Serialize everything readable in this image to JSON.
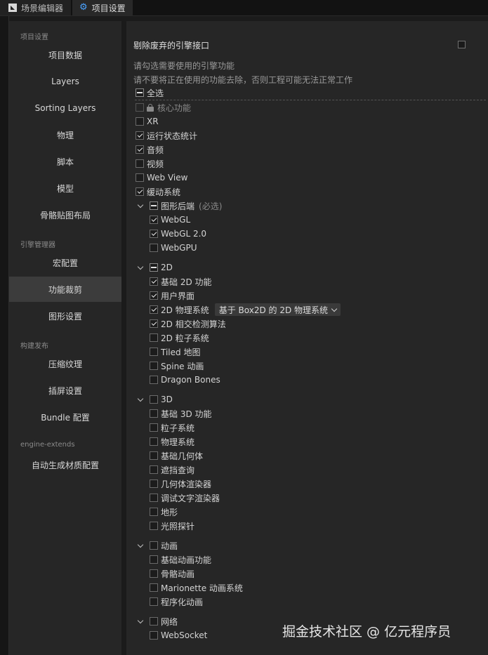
{
  "tabs": [
    {
      "label": "场景编辑器"
    },
    {
      "label": "项目设置"
    }
  ],
  "sidebar": {
    "sections": [
      {
        "title": "项目设置",
        "items": [
          "项目数据",
          "Layers",
          "Sorting Layers",
          "物理",
          "脚本",
          "模型",
          "骨骼贴图布局"
        ]
      },
      {
        "title": "引擎管理器",
        "items": [
          "宏配置",
          "功能裁剪",
          "图形设置"
        ]
      },
      {
        "title": "构建发布",
        "items": [
          "压缩纹理",
          "插屏设置",
          "Bundle 配置"
        ]
      },
      {
        "title": "engine-extends",
        "items": [
          "自动生成材质配置"
        ]
      }
    ],
    "active": "功能裁剪"
  },
  "main": {
    "header": "剔除废弃的引擎接口",
    "note1": "请勾选需要使用的引擎功能",
    "note2": "请不要将正在使用的功能去除，否则工程可能无法正常工作",
    "select_all": "全选",
    "top_items": [
      {
        "label": "核心功能",
        "state": "disabled"
      },
      {
        "label": "XR",
        "state": "unchecked"
      },
      {
        "label": "运行状态统计",
        "state": "checked"
      },
      {
        "label": "音频",
        "state": "checked"
      },
      {
        "label": "视频",
        "state": "unchecked"
      },
      {
        "label": "Web View",
        "state": "unchecked"
      },
      {
        "label": "缓动系统",
        "state": "checked"
      }
    ],
    "groups": [
      {
        "label": "图形后端",
        "suffix": "(必选)",
        "state": "partial",
        "items": [
          {
            "label": "WebGL",
            "state": "checked"
          },
          {
            "label": "WebGL 2.0",
            "state": "checked"
          },
          {
            "label": "WebGPU",
            "state": "unchecked"
          }
        ]
      },
      {
        "label": "2D",
        "state": "partial",
        "items": [
          {
            "label": "基础 2D 功能",
            "state": "checked"
          },
          {
            "label": "用户界面",
            "state": "checked"
          },
          {
            "label": "2D 物理系统",
            "state": "checked",
            "select": "基于 Box2D 的 2D 物理系统"
          },
          {
            "label": "2D 相交检测算法",
            "state": "checked"
          },
          {
            "label": "2D 粒子系统",
            "state": "unchecked"
          },
          {
            "label": "Tiled 地图",
            "state": "unchecked"
          },
          {
            "label": "Spine 动画",
            "state": "unchecked"
          },
          {
            "label": "Dragon Bones",
            "state": "unchecked"
          }
        ]
      },
      {
        "label": "3D",
        "state": "unchecked",
        "items": [
          {
            "label": "基础 3D 功能",
            "state": "unchecked"
          },
          {
            "label": "粒子系统",
            "state": "unchecked"
          },
          {
            "label": "物理系统",
            "state": "unchecked"
          },
          {
            "label": "基础几何体",
            "state": "unchecked"
          },
          {
            "label": "遮挡查询",
            "state": "unchecked"
          },
          {
            "label": "几何体渲染器",
            "state": "unchecked"
          },
          {
            "label": "调试文字渲染器",
            "state": "unchecked"
          },
          {
            "label": "地形",
            "state": "unchecked"
          },
          {
            "label": "光照探针",
            "state": "unchecked"
          }
        ]
      },
      {
        "label": "动画",
        "state": "unchecked",
        "items": [
          {
            "label": "基础动画功能",
            "state": "unchecked"
          },
          {
            "label": "骨骼动画",
            "state": "unchecked"
          },
          {
            "label": "Marionette 动画系统",
            "state": "unchecked"
          },
          {
            "label": "程序化动画",
            "state": "unchecked"
          }
        ]
      },
      {
        "label": "网络",
        "state": "unchecked",
        "items": [
          {
            "label": "WebSocket",
            "state": "unchecked"
          }
        ]
      }
    ]
  },
  "watermark": "掘金技术社区 @ 亿元程序员",
  "colors": {
    "background": "#1b1b1b",
    "panel": "#262626",
    "active_item": "#3c3c3c",
    "accent": "#4aa3ff"
  }
}
